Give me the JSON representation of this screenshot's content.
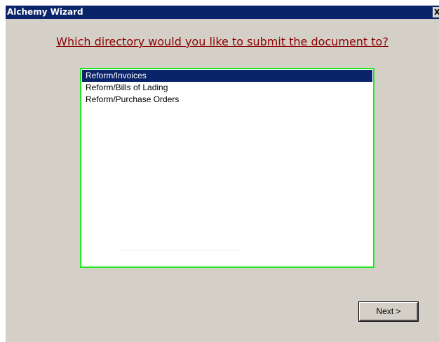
{
  "window": {
    "title": "Alchemy Wizard",
    "close_glyph": "X"
  },
  "question": "Which directory would you like to submit the document to?",
  "directory_list": {
    "items": [
      {
        "label": "Reform/Invoices",
        "selected": true
      },
      {
        "label": "Reform/Bills of Lading",
        "selected": false
      },
      {
        "label": "Reform/Purchase Orders",
        "selected": false
      }
    ]
  },
  "buttons": {
    "next_label": "Next >"
  },
  "colors": {
    "titlebar": "#0a246a",
    "dialog_background": "#d4d0c8",
    "question_text": "#8b0000",
    "list_border": "#22e622",
    "selection": "#0a246a"
  }
}
